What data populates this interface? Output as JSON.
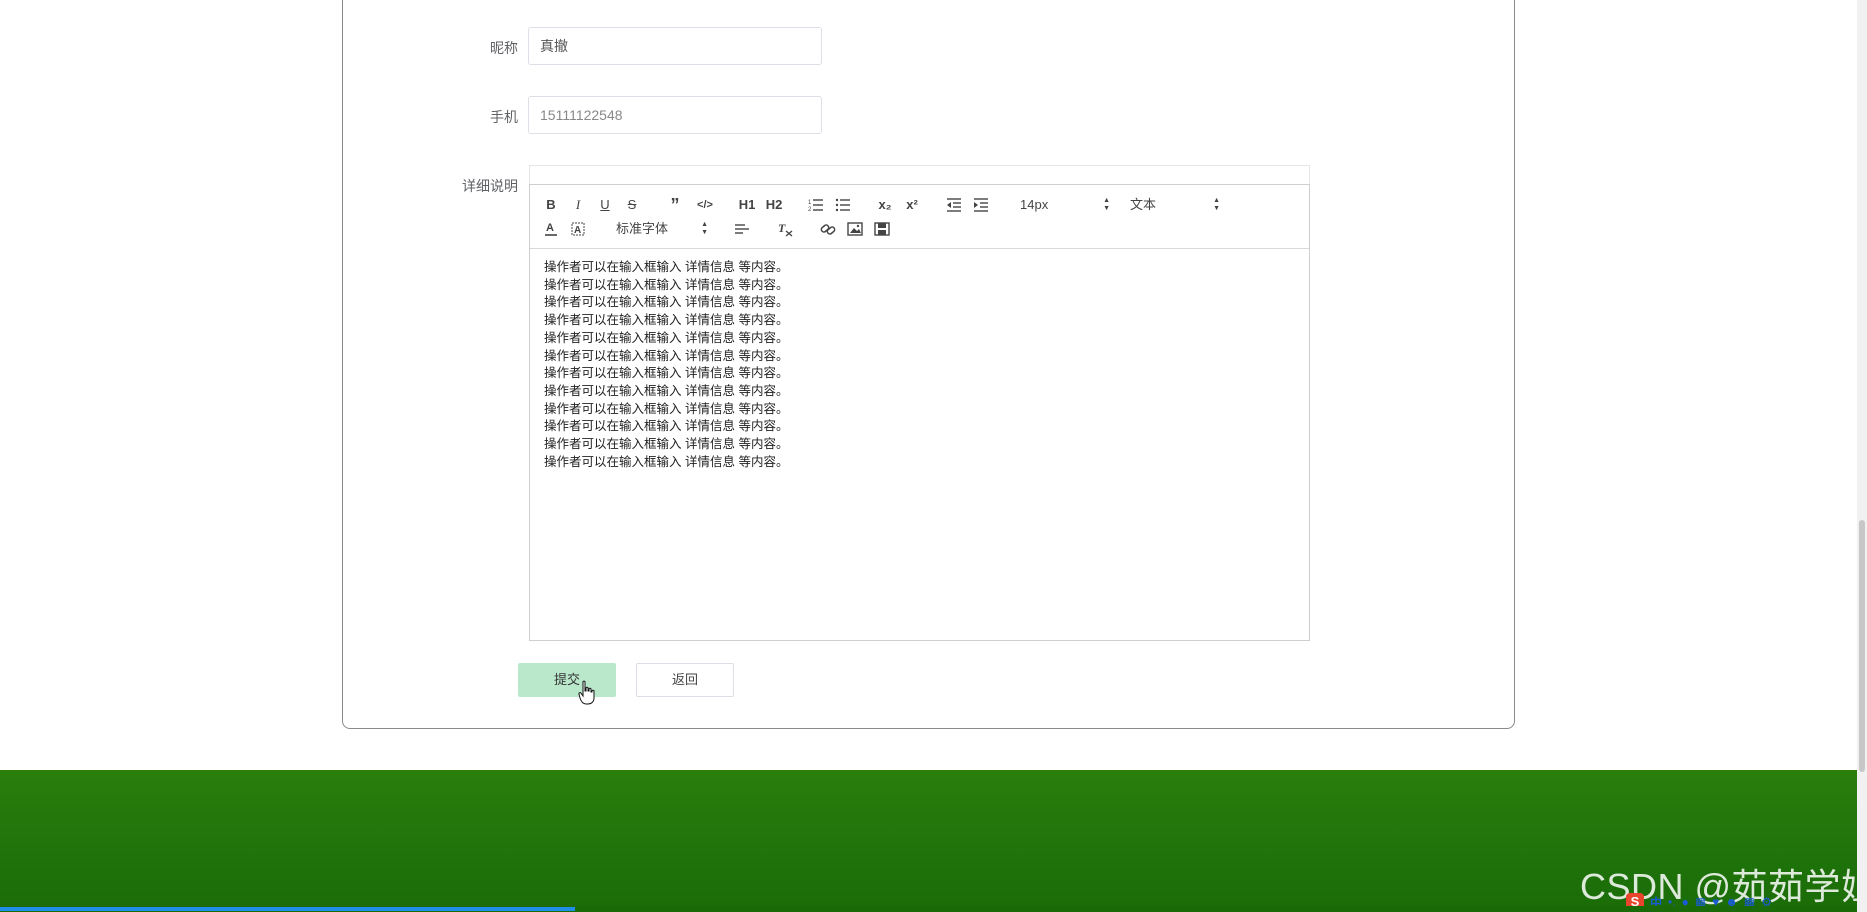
{
  "form": {
    "nickname_label": "昵称",
    "nickname_value": "真撤",
    "phone_label": "手机",
    "phone_value": "15111122548",
    "detail_label": "详细说明"
  },
  "toolbar": {
    "bold": "B",
    "italic": "I",
    "underline": "U",
    "strike": "S",
    "blockquote": "”",
    "code": "</>",
    "h1": "H1",
    "h2": "H2",
    "subscript": "x₂",
    "superscript": "x²",
    "size_value": "14px",
    "header_value": "文本",
    "font_value": "标准字体"
  },
  "editor": {
    "lines": [
      "操作者可以在输入框输入 详情信息 等内容。",
      "操作者可以在输入框输入 详情信息 等内容。",
      "操作者可以在输入框输入 详情信息 等内容。",
      "操作者可以在输入框输入 详情信息 等内容。",
      "操作者可以在输入框输入 详情信息 等内容。",
      "操作者可以在输入框输入 详情信息 等内容。",
      "操作者可以在输入框输入 详情信息 等内容。",
      "操作者可以在输入框输入 详情信息 等内容。",
      "操作者可以在输入框输入 详情信息 等内容。",
      "操作者可以在输入框输入 详情信息 等内容。",
      "操作者可以在输入框输入 详情信息 等内容。",
      "操作者可以在输入框输入 详情信息 等内容。"
    ]
  },
  "buttons": {
    "submit": "提交",
    "back": "返回"
  },
  "watermark": "CSDN @茹茹学姐",
  "tray": {
    "ime": "中"
  },
  "colors": {
    "submit_bg": "#b9e8cb",
    "footer_green": "#1f730a",
    "progress_blue": "#1f8fe6"
  }
}
